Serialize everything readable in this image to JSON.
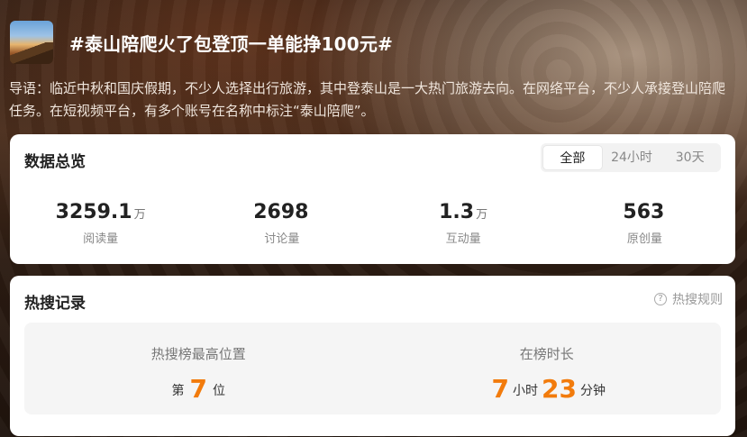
{
  "topic": {
    "title": "#泰山陪爬火了包登顶一单能挣100元#",
    "intro": "导语：临近中秋和国庆假期，不少人选择出行旅游，其中登泰山是一大热门旅游去向。在网络平台，不少人承接登山陪爬任务。在短视频平台，有多个账号在名称中标注“泰山陪爬”。"
  },
  "overview": {
    "title": "数据总览",
    "tabs": [
      {
        "label": "全部",
        "active": true
      },
      {
        "label": "24小时",
        "active": false
      },
      {
        "label": "30天",
        "active": false
      }
    ],
    "stats": [
      {
        "value": "3259.1",
        "unit": "万",
        "label": "阅读量"
      },
      {
        "value": "2698",
        "unit": "",
        "label": "讨论量"
      },
      {
        "value": "1.3",
        "unit": "万",
        "label": "互动量"
      },
      {
        "value": "563",
        "unit": "",
        "label": "原创量"
      }
    ]
  },
  "hot_search": {
    "title": "热搜记录",
    "rules_label": "热搜规则",
    "highest_position": {
      "label": "热搜榜最高位置",
      "prefix": "第",
      "value": "7",
      "suffix": "位"
    },
    "duration": {
      "label": "在榜时长",
      "hours": "7",
      "hours_unit": "小时",
      "minutes": "23",
      "minutes_unit": "分钟"
    }
  }
}
